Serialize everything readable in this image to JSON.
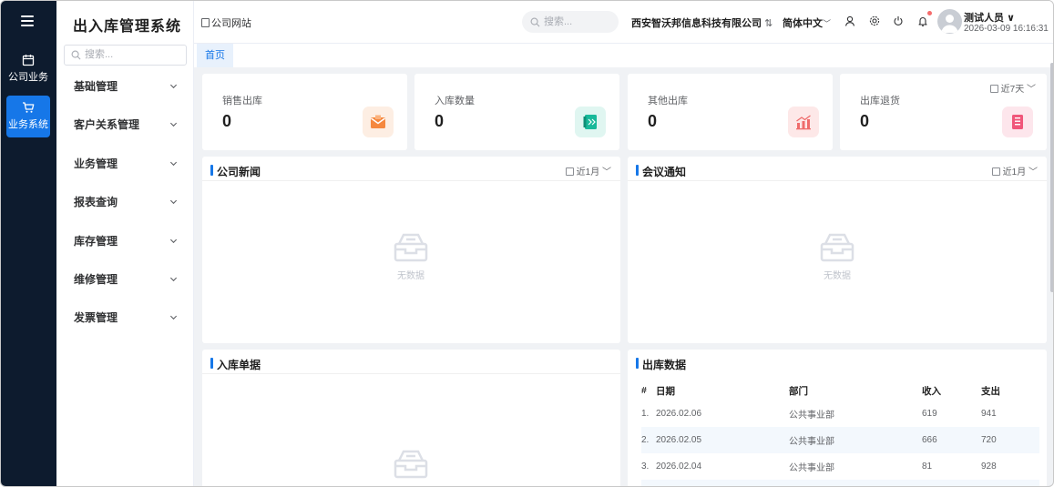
{
  "rail": {
    "items": [
      {
        "label": "公司业务",
        "icon": "calendar-icon"
      },
      {
        "label": "业务系统",
        "icon": "cart-icon"
      }
    ]
  },
  "sidebar": {
    "title": "出入库管理系统",
    "search_placeholder": "搜索...",
    "items": [
      {
        "label": "基础管理"
      },
      {
        "label": "客户关系管理"
      },
      {
        "label": "业务管理"
      },
      {
        "label": "报表查询"
      },
      {
        "label": "库存管理"
      },
      {
        "label": "维修管理"
      },
      {
        "label": "发票管理"
      }
    ]
  },
  "topbar": {
    "site_link": "公司网站",
    "search_placeholder": "搜索...",
    "company": "西安智沃邦信息科技有限公司",
    "language": "简体中文",
    "user_name": "测试人员",
    "datetime": "2026-03-09 16:16:31"
  },
  "tabs": {
    "home": "首页"
  },
  "stats": {
    "range": "近7天",
    "cards": [
      {
        "label": "销售出库",
        "value": "0",
        "icon": "mail-icon",
        "color": "#f5883f",
        "bg": "#fdeee3"
      },
      {
        "label": "入库数量",
        "value": "0",
        "icon": "book-icon",
        "color": "#19b99a",
        "bg": "#e0f6f1"
      },
      {
        "label": "其他出库",
        "value": "0",
        "icon": "chart-icon",
        "color": "#ef6b6b",
        "bg": "#fde8e8"
      },
      {
        "label": "出库退货",
        "value": "0",
        "icon": "document-icon",
        "color": "#f0567a",
        "bg": "#fde6ec"
      }
    ]
  },
  "news": {
    "title": "公司新闻",
    "range": "近1月",
    "empty": "无数据"
  },
  "meeting": {
    "title": "会议通知",
    "range": "近1月",
    "empty": "无数据"
  },
  "inbound": {
    "title": "入库单据"
  },
  "outbound": {
    "title": "出库数据",
    "columns": [
      "#",
      "日期",
      "部门",
      "收入",
      "支出"
    ],
    "rows": [
      {
        "no": "1.",
        "date": "2026.02.06",
        "dept": "公共事业部",
        "income": "619",
        "expense": "941"
      },
      {
        "no": "2.",
        "date": "2026.02.05",
        "dept": "公共事业部",
        "income": "666",
        "expense": "720"
      },
      {
        "no": "3.",
        "date": "2026.02.04",
        "dept": "公共事业部",
        "income": "81",
        "expense": "928"
      }
    ]
  },
  "colors": {
    "accent": "#1677e8",
    "rail_bg": "#0d1b2e",
    "notice_dot": "#f56c6c"
  }
}
